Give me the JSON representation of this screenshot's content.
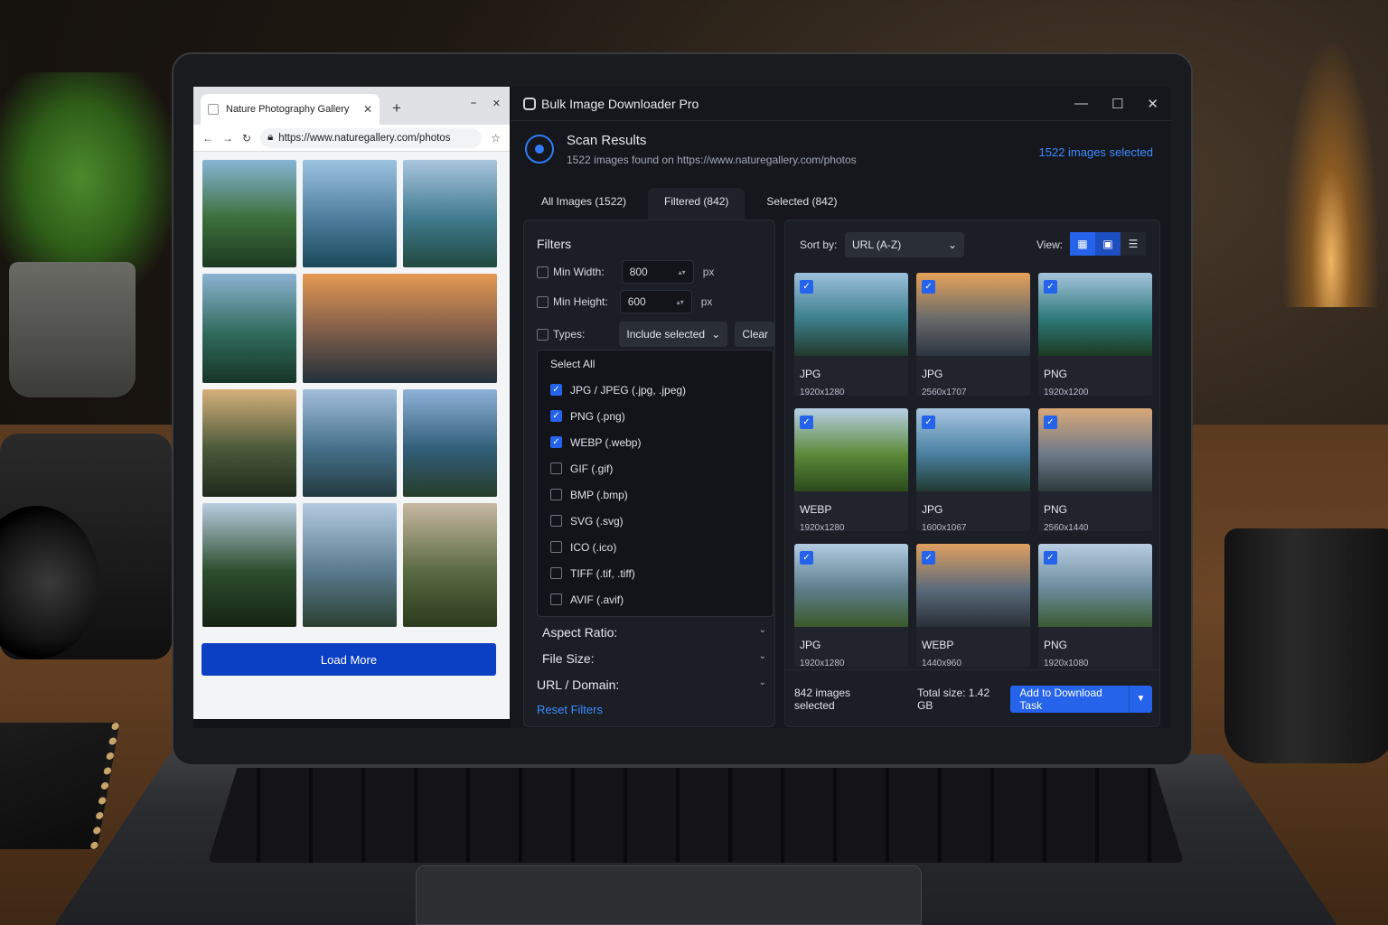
{
  "browser": {
    "tab_title": "Nature Photography Gallery",
    "url": "https://www.naturegallery.com/photos",
    "new_tab_icon": "+",
    "load_more_label": "Load More",
    "photos": [
      {
        "name": "waterfall",
        "colors": [
          "#86b5d6",
          "#3c6e3a",
          "#1d3a22"
        ]
      },
      {
        "name": "lake-mountains",
        "colors": [
          "#9cc3e0",
          "#4d7d9c",
          "#1a4a5a"
        ]
      },
      {
        "name": "lake-mountains-2",
        "colors": [
          "#a9c6df",
          "#3f7a8e",
          "#21493e"
        ]
      },
      {
        "name": "waterfall-2",
        "colors": [
          "#8cb3d3",
          "#2f6a5a",
          "#173528"
        ]
      },
      {
        "name": "sunset-coast",
        "colors": [
          "#e59a52",
          "#7a5a4a",
          "#23303a"
        ]
      },
      {
        "name": "forest-sun",
        "colors": [
          "#d6b07a",
          "#4a5a3a",
          "#1f2a1c"
        ]
      },
      {
        "name": "mountain-lake",
        "colors": [
          "#a2bedb",
          "#46708a",
          "#223a40"
        ]
      },
      {
        "name": "valley-river",
        "colors": [
          "#8fb2d8",
          "#325f7a",
          "#263c2a"
        ]
      },
      {
        "name": "pine-forest",
        "colors": [
          "#b9cde0",
          "#2d4d2d",
          "#142414"
        ]
      },
      {
        "name": "mountain-valley",
        "colors": [
          "#b3cae0",
          "#5a7a8e",
          "#2a4030"
        ]
      },
      {
        "name": "meadow-peaks",
        "colors": [
          "#c7b8a2",
          "#5a6a42",
          "#2a3a1c"
        ]
      }
    ]
  },
  "app": {
    "title": "Bulk Image Downloader Pro",
    "scan_title": "Scan Results",
    "scan_subtitle": "1522 images found on https://www.naturegallery.com/photos",
    "selected_header": "1522 images selected",
    "tabs": [
      "All Images (1522)",
      "Filtered (842)",
      "Selected (842)"
    ],
    "filters": {
      "title": "Filters",
      "min_width_label": "Min Width:",
      "min_width_value": "800",
      "min_height_label": "Min Height:",
      "min_height_value": "600",
      "unit": "px",
      "types_label": "Types:",
      "types_mode": "Include selected",
      "clear_label": "Clear",
      "select_all_label": "Select All",
      "types": [
        {
          "label": "JPG / JPEG (.jpg, .jpeg)",
          "checked": true
        },
        {
          "label": "PNG (.png)",
          "checked": true
        },
        {
          "label": "WEBP (.webp)",
          "checked": true
        },
        {
          "label": "GIF (.gif)",
          "checked": false
        },
        {
          "label": "BMP (.bmp)",
          "checked": false
        },
        {
          "label": "SVG (.svg)",
          "checked": false
        },
        {
          "label": "ICO (.ico)",
          "checked": false
        },
        {
          "label": "TIFF (.tif, .tiff)",
          "checked": false
        },
        {
          "label": "AVIF (.avif)",
          "checked": false
        }
      ],
      "aspect_ratio_label": "Aspect Ratio:",
      "file_size_label": "File Size:",
      "url_domain_label": "URL / Domain:",
      "reset_label": "Reset Filters"
    },
    "results": {
      "sort_label": "Sort by:",
      "sort_value": "URL (A-Z)",
      "view_label": "View:",
      "cards": [
        {
          "format": "JPG",
          "resolution": "1920x1280",
          "colors": [
            "#9cc0dc",
            "#3d7f8c",
            "#213a2c"
          ]
        },
        {
          "format": "JPG",
          "resolution": "2560x1707",
          "colors": [
            "#e6a25a",
            "#6a6a6a",
            "#2b3540"
          ]
        },
        {
          "format": "PNG",
          "resolution": "1920x1200",
          "colors": [
            "#a6c4de",
            "#2f7a7a",
            "#1c3a22"
          ]
        },
        {
          "format": "WEBP",
          "resolution": "1920x1280",
          "colors": [
            "#b8d0e6",
            "#5d8a3a",
            "#2a4a1a"
          ]
        },
        {
          "format": "JPG",
          "resolution": "1600x1067",
          "colors": [
            "#a8c6e2",
            "#4a80a0",
            "#213a30"
          ]
        },
        {
          "format": "PNG",
          "resolution": "2560x1440",
          "colors": [
            "#d9a878",
            "#6e7a8a",
            "#2d3a3a"
          ]
        },
        {
          "format": "JPG",
          "resolution": "1920x1280",
          "colors": [
            "#b2cbe2",
            "#5d7d8a",
            "#3a5a2a"
          ]
        },
        {
          "format": "WEBP",
          "resolution": "1440x960",
          "colors": [
            "#e0a060",
            "#5a6a7a",
            "#2a3038"
          ]
        },
        {
          "format": "PNG",
          "resolution": "1920x1080",
          "colors": [
            "#b9cde3",
            "#6a8a9a",
            "#3a5a30"
          ]
        }
      ],
      "footer_selected": "842 images selected",
      "footer_total": "Total size: 1.42 GB",
      "add_button_label": "Add to Download Task"
    }
  }
}
